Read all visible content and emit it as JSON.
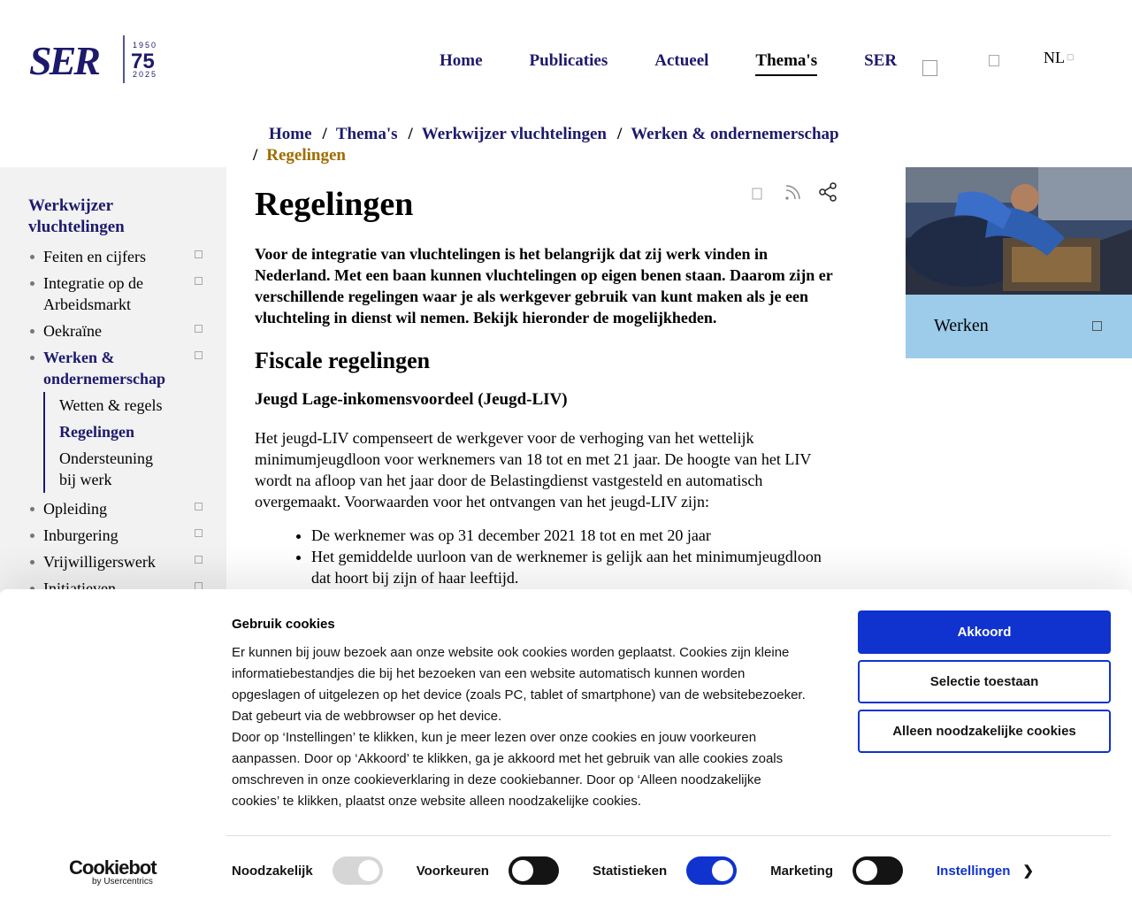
{
  "header": {
    "logo": {
      "text": "SER",
      "years_top": "1950",
      "anniversary": "75",
      "years_bottom": "2025"
    },
    "nav": [
      {
        "label": "Home",
        "active": false
      },
      {
        "label": "Publicaties",
        "active": false
      },
      {
        "label": "Actueel",
        "active": false
      },
      {
        "label": "Thema's",
        "active": true
      },
      {
        "label": "SER",
        "active": false
      }
    ],
    "icons": [
      "search-icon",
      "bookmark-icon"
    ],
    "language": "NL"
  },
  "breadcrumb": [
    "Home",
    "Thema's",
    "Werkwijzer vluchtelingen",
    "Werken & ondernemerschap",
    "Regelingen"
  ],
  "sidebar": {
    "title": "Werkwijzer vluchtelingen",
    "items": [
      {
        "label": "Feiten en cijfers"
      },
      {
        "label": "Integratie op de Arbeidsmarkt"
      },
      {
        "label": "Oekraïne"
      },
      {
        "label": "Werken & ondernemerschap",
        "active": true,
        "children": [
          "Wetten & regels",
          "Regelingen",
          "Ondersteuning bij werk"
        ]
      },
      {
        "label": "Opleiding"
      },
      {
        "label": "Inburgering"
      },
      {
        "label": "Vrijwilligerswerk"
      },
      {
        "label": "Initiatieven"
      }
    ]
  },
  "main": {
    "title": "Regelingen",
    "tools": [
      "bookmark-icon",
      "rss-icon",
      "share-icon"
    ],
    "lead": "Voor de integratie van vluchtelingen is het belangrijk dat zij werk vinden in Nederland. Met een baan kunnen vluchtelingen op eigen benen staan. Daarom zijn er verschillende regelingen waar je als werkgever gebruik van kunt maken als je een vluchteling in dienst wil nemen. Bekijk hieronder de mogelijkheden.",
    "section_title": "Fiscale regelingen",
    "subsection_title": "Jeugd Lage-inkomensvoordeel (Jeugd-LIV)",
    "paragraph": "Het jeugd-LIV compenseert de werkgever voor de verhoging van het wettelijk minimumjeugdloon voor werknemers van 18 tot en met 21 jaar. De hoogte van het LIV wordt na afloop van het jaar door de Belastingdienst vastgesteld en automatisch overgemaakt. Voorwaarden voor het ontvangen van het jeugd-LIV zijn:",
    "bullets": [
      "De werknemer was op 31 december 2021 18 tot en met 20 jaar",
      "Het gemiddelde uurloon van de werknemer is gelijk aan het minimumjeugdloon dat hoort bij zijn of haar leeftijd."
    ]
  },
  "card": {
    "label": "Werken"
  },
  "cookie": {
    "title": "Gebruik cookies",
    "text_1": "Er kunnen bij jouw bezoek aan onze website ook cookies worden geplaatst. Cookies zijn kleine informatiebestandjes die bij het bezoeken van een website automatisch kunnen worden opgeslagen of uitgelezen op het device (zoals PC, tablet of smartphone) van de websitebezoeker. Dat gebeurt via de webbrowser op het device.",
    "text_2": "Door op ‘Instellingen’ te klikken, kun je meer lezen over onze cookies en jouw voorkeuren aanpassen. Door op ‘Akkoord’ te klikken, ga je akkoord met het gebruik van alle cookies zoals omschreven in onze cookieverklaring in deze cookiebanner. Door op ‘Alleen noodzakelijke cookies’ te klikken, plaatst onze website alleen noodzakelijke cookies.",
    "buttons": {
      "accept": "Akkoord",
      "selection": "Selectie toestaan",
      "necessary": "Alleen noodzakelijke cookies"
    },
    "brand": "Cookiebot",
    "brand_sub": "by Usercentrics",
    "toggles": [
      {
        "label": "Noodzakelijk",
        "state": "disabled-on"
      },
      {
        "label": "Voorkeuren",
        "state": "off"
      },
      {
        "label": "Statistieken",
        "state": "on"
      },
      {
        "label": "Marketing",
        "state": "off"
      }
    ],
    "settings": "Instellingen",
    "colors": {
      "primary": "#1032cf",
      "navy": "#1d1a6b",
      "card": "#9ccce9",
      "crumb_current": "#a06c00"
    }
  }
}
